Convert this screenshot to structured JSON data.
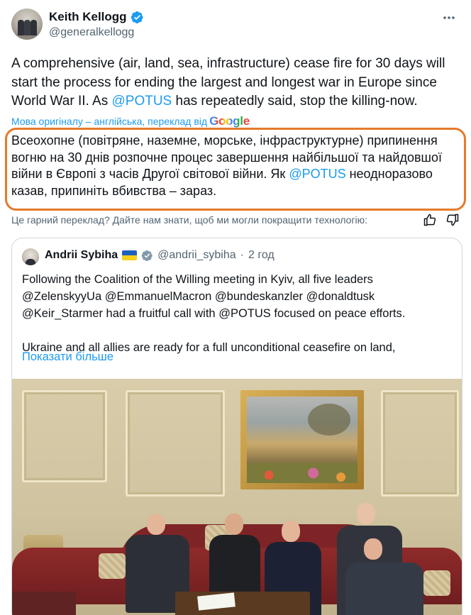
{
  "author": {
    "display_name": "Keith Kellogg",
    "handle": "@generalkellogg"
  },
  "tweet": {
    "text_part1": "A comprehensive (air, land, sea, infrastructure) cease fire for 30 days will start the process for ending the largest and longest war in Europe since World War II.  As ",
    "mention": "@POTUS",
    "text_part2": " has repeatedly said, stop the killing-now."
  },
  "translation": {
    "source_note": "Мова оригіналу – англійська, переклад від",
    "provider_logo_text": "Google",
    "text_part1": "Всеохопне (повітряне, наземне, морське, інфраструктурне) припинення вогню на 30 днів розпочне процес завершення найбільшої та найдовшої війни в Європі з часів Другої світової війни. Як ",
    "mention": "@POTUS",
    "text_part2": " неодноразово казав, припиніть вбивства – зараз.",
    "highlight_color": "#e57a2c",
    "feedback_prompt": "Це гарний переклад? Дайте нам знати, щоб ми могли покращити технологію:"
  },
  "quote": {
    "display_name": "Andrii Sybiha",
    "handle": "@andrii_sybiha",
    "separator": "·",
    "time": "2 год",
    "paragraph1": "Following the Coalition of the Willing meeting in Kyiv, all five leaders @ZelenskyyUa @EmmanuelMacron @bundeskanzler @donaldtusk @Keir_Starmer had a fruitful call with @POTUS focused on peace efforts.",
    "paragraph2": "Ukraine and all allies are ready for a full unconditional ceasefire on land,",
    "show_more": "Показати більше"
  },
  "icons": {
    "verified": "verified-badge-icon",
    "more": "more-icon",
    "thumb_up": "thumb-up-icon",
    "thumb_down": "thumb-down-icon",
    "flag": "ukraine-flag-icon"
  },
  "colors": {
    "link": "#1d9bf0",
    "text": "#0f1419",
    "muted": "#536471",
    "verified": "#1d9bf0"
  }
}
